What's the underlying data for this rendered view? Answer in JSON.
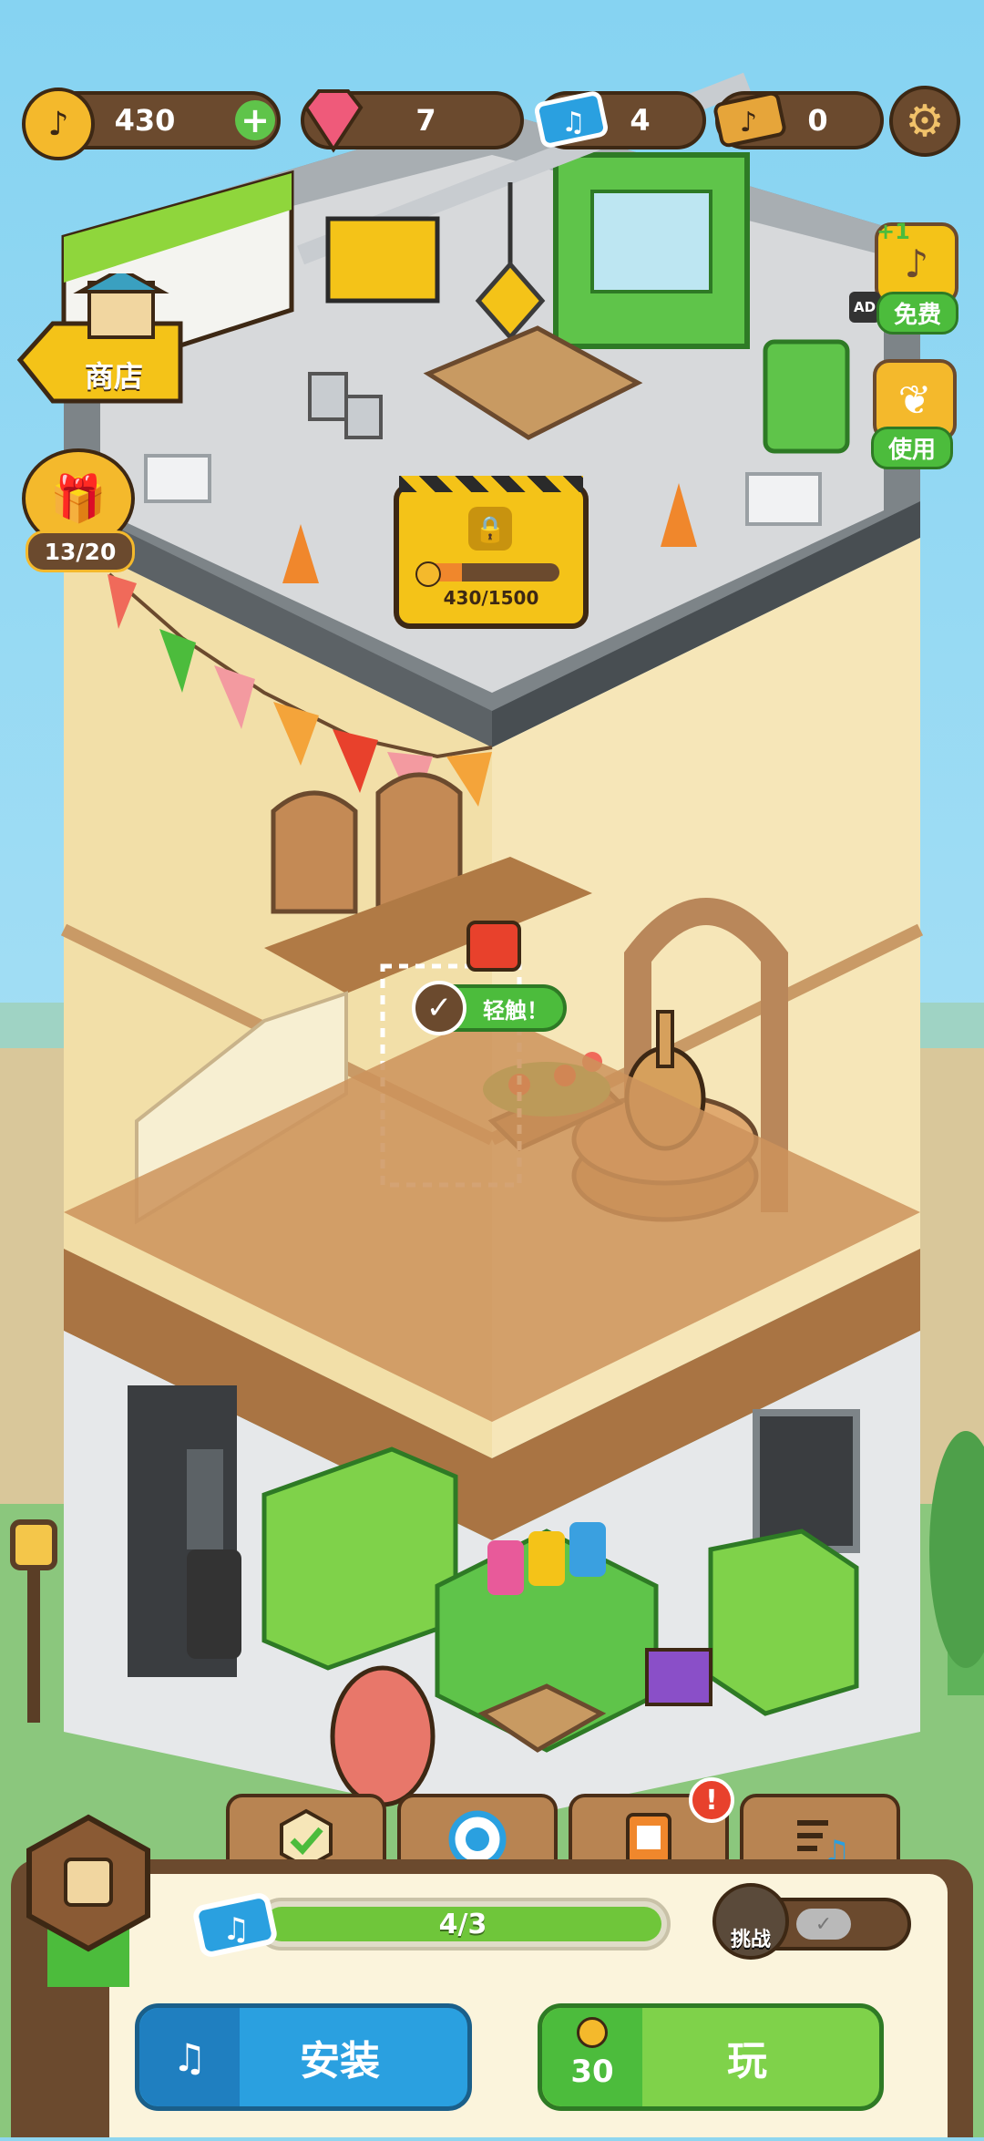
{
  "currencies": {
    "coins": "430",
    "gems": "7",
    "tickets": "4",
    "golden_tickets": "0"
  },
  "side_buttons": {
    "shop_label": "商店",
    "keys_progress": "13/20",
    "free_label": "免费",
    "free_badge": "+1",
    "ad_label": "AD",
    "use_label": "使用"
  },
  "locked_floor": {
    "progress_text": "430/1500",
    "progress_fraction": 0.287
  },
  "scene_hint": {
    "tap_label": "轻触！"
  },
  "bottom_panel": {
    "ticket_progress_text": "4/3",
    "ticket_progress_fraction": 1.0,
    "challenge_label": "挑战",
    "install_label": "安装",
    "play_label": "玩",
    "play_cost": "30"
  },
  "colors": {
    "sky": "#8fd6f0",
    "wall_cream": "#f6e6b8",
    "wood_brown": "#b88452",
    "accent_green": "#4cbc3c",
    "accent_blue": "#2aa0e0",
    "alert_red": "#e8412c"
  }
}
